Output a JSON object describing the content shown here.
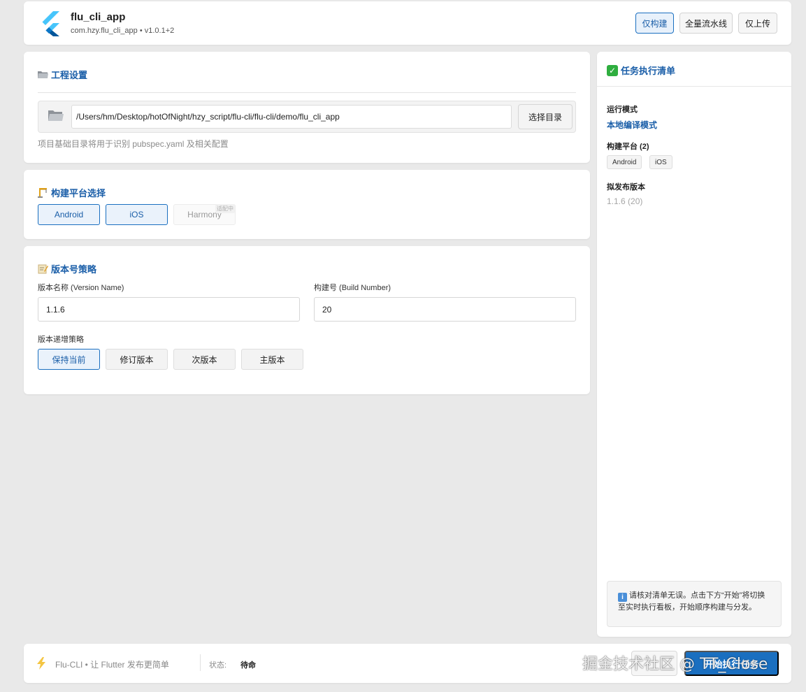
{
  "header": {
    "app_name": "flu_cli_app",
    "app_subtitle": "com.hzy.flu_cli_app • v1.0.1+2",
    "buttons": [
      "仅构建",
      "全量流水线",
      "仅上传"
    ]
  },
  "project": {
    "title": "工程设置",
    "path": "/Users/hm/Desktop/hotOfNight/hzy_script/flu-cli/flu-cli/demo/flu_cli_app",
    "choose_label": "选择目录",
    "hint": "项目基础目录将用于识别 pubspec.yaml 及相关配置"
  },
  "platform": {
    "title": "构建平台选择",
    "options": [
      "Android",
      "iOS",
      "Harmony"
    ],
    "harmony_badge": "适配中"
  },
  "version": {
    "title": "版本号策略",
    "name_label": "版本名称 (Version Name)",
    "name_value": "1.1.6",
    "build_label": "构建号 (Build Number)",
    "build_value": "20",
    "strategy_label": "版本递增策略",
    "strategies": [
      "保持当前",
      "修订版本",
      "次版本",
      "主版本"
    ]
  },
  "tasks": {
    "title": "任务执行清单",
    "mode_label": "运行模式",
    "mode_value": "本地编译模式",
    "platforms_label": "构建平台 (2)",
    "platform_tags": [
      "Android",
      "iOS"
    ],
    "release_label": "拟发布版本",
    "release_value": "1.1.6 (20)",
    "note": "请核对清单无误。点击下方“开始”将切换至实时执行看板，开始顺序构建与分发。"
  },
  "footer": {
    "brand": "Flu-CLI • 让 Flutter 发布更简单",
    "status_label": "状态:",
    "status_value": "待命",
    "primary_label": "开始执行任务"
  },
  "watermark": "掘金技术社区 @ TT_Close",
  "colors": {
    "accent": "#1a6fc0",
    "accent_text": "#1a5ea8",
    "background": "#e9e9e9"
  }
}
